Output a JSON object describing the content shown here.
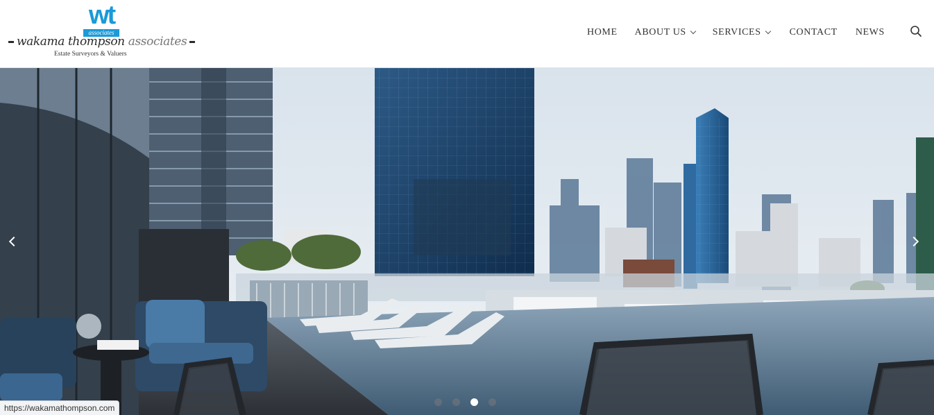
{
  "logo": {
    "mark": "wt",
    "mark_sub": "associates",
    "name_dark": "wakama thompson",
    "name_light": "associates",
    "tagline": "Estate Surveyors & Valuers",
    "brand_color": "#1a9ad8"
  },
  "nav": {
    "items": [
      {
        "label": "HOME",
        "has_dropdown": false
      },
      {
        "label": "ABOUT US",
        "has_dropdown": true
      },
      {
        "label": "SERVICES",
        "has_dropdown": true
      },
      {
        "label": "CONTACT",
        "has_dropdown": false
      },
      {
        "label": "NEWS",
        "has_dropdown": false
      }
    ],
    "search_icon": "search-icon"
  },
  "hero": {
    "slides_total": 4,
    "active_slide": 3,
    "prev_icon": "chevron-left-icon",
    "next_icon": "chevron-right-icon"
  },
  "status_bar": {
    "url": "https://wakamathompson.com"
  }
}
